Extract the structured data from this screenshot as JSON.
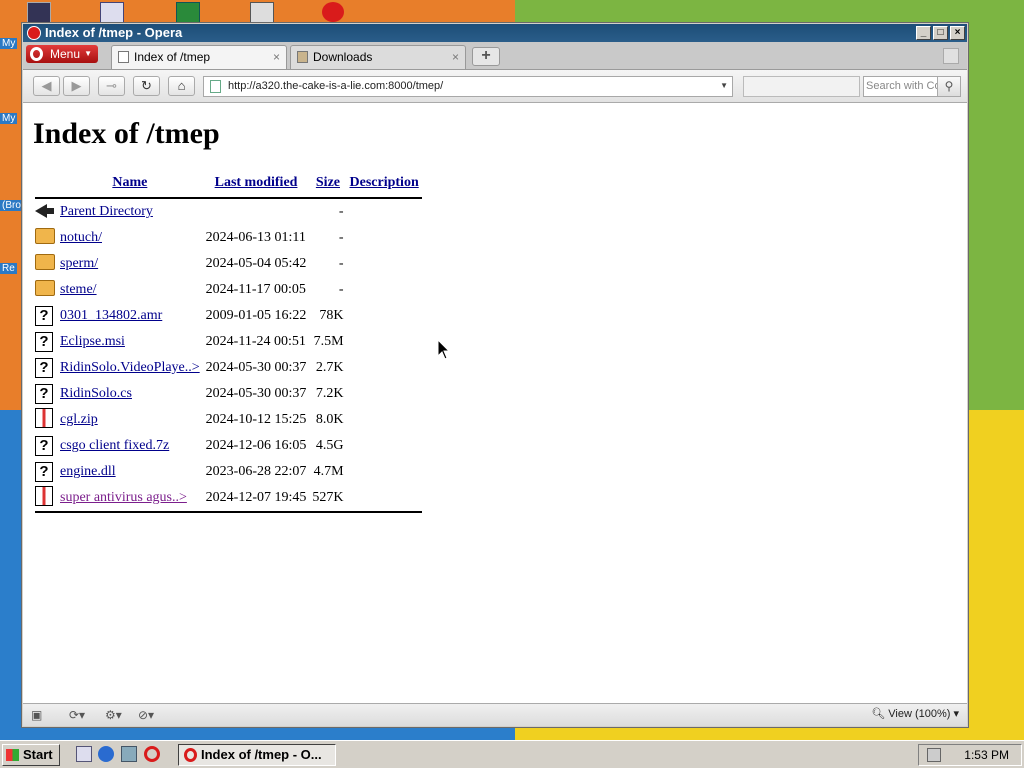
{
  "window": {
    "title": "Index of /tmep - Opera"
  },
  "menu_label": "Menu",
  "tabs": [
    {
      "label": "Index of /tmep",
      "active": true
    },
    {
      "label": "Downloads",
      "active": false
    }
  ],
  "address_bar": {
    "url": "http://a320.the-cake-is-a-lie.com:8000/tmep/"
  },
  "search": {
    "placeholder": "Search with Co"
  },
  "page": {
    "heading": "Index of /tmep",
    "columns": [
      "Name",
      "Last modified",
      "Size",
      "Description"
    ],
    "rows": [
      {
        "icon": "back",
        "name": "Parent Directory",
        "modified": "",
        "size": "-"
      },
      {
        "icon": "folder",
        "name": "notuch/",
        "modified": "2024-06-13 01:11",
        "size": "-"
      },
      {
        "icon": "folder",
        "name": "sperm/",
        "modified": "2024-05-04 05:42",
        "size": "-"
      },
      {
        "icon": "folder",
        "name": "steme/",
        "modified": "2024-11-17 00:05",
        "size": "-"
      },
      {
        "icon": "unknown",
        "name": "0301_134802.amr",
        "modified": "2009-01-05 16:22",
        "size": "78K"
      },
      {
        "icon": "unknown",
        "name": "Eclipse.msi",
        "modified": "2024-11-24 00:51",
        "size": "7.5M"
      },
      {
        "icon": "unknown",
        "name": "RidinSolo.VideoPlaye..>",
        "modified": "2024-05-30 00:37",
        "size": "2.7K"
      },
      {
        "icon": "unknown",
        "name": "RidinSolo.cs",
        "modified": "2024-05-30 00:37",
        "size": "7.2K"
      },
      {
        "icon": "compressed",
        "name": "cgl.zip",
        "modified": "2024-10-12 15:25",
        "size": "8.0K"
      },
      {
        "icon": "unknown",
        "name": "csgo client fixed.7z",
        "modified": "2024-12-06 16:05",
        "size": "4.5G"
      },
      {
        "icon": "unknown",
        "name": "engine.dll",
        "modified": "2023-06-28 22:07",
        "size": "4.7M"
      },
      {
        "icon": "compressed",
        "name": "super antivirus agus..>",
        "modified": "2024-12-07 19:45",
        "size": "527K",
        "visited": true
      }
    ]
  },
  "statusbar": {
    "zoom_label": "View (100%)"
  },
  "taskbar": {
    "start_label": "Start",
    "task_label": "Index of /tmep - O...",
    "clock": "1:53 PM"
  },
  "desktop": {
    "icon_labels": [
      "My",
      "My",
      "(Bro",
      "Re"
    ]
  },
  "colors": {
    "titlebar": "#1d4e78",
    "link": "#00008b",
    "visited_link": "#7b1e8c",
    "opera_red": "#d91b1b"
  }
}
